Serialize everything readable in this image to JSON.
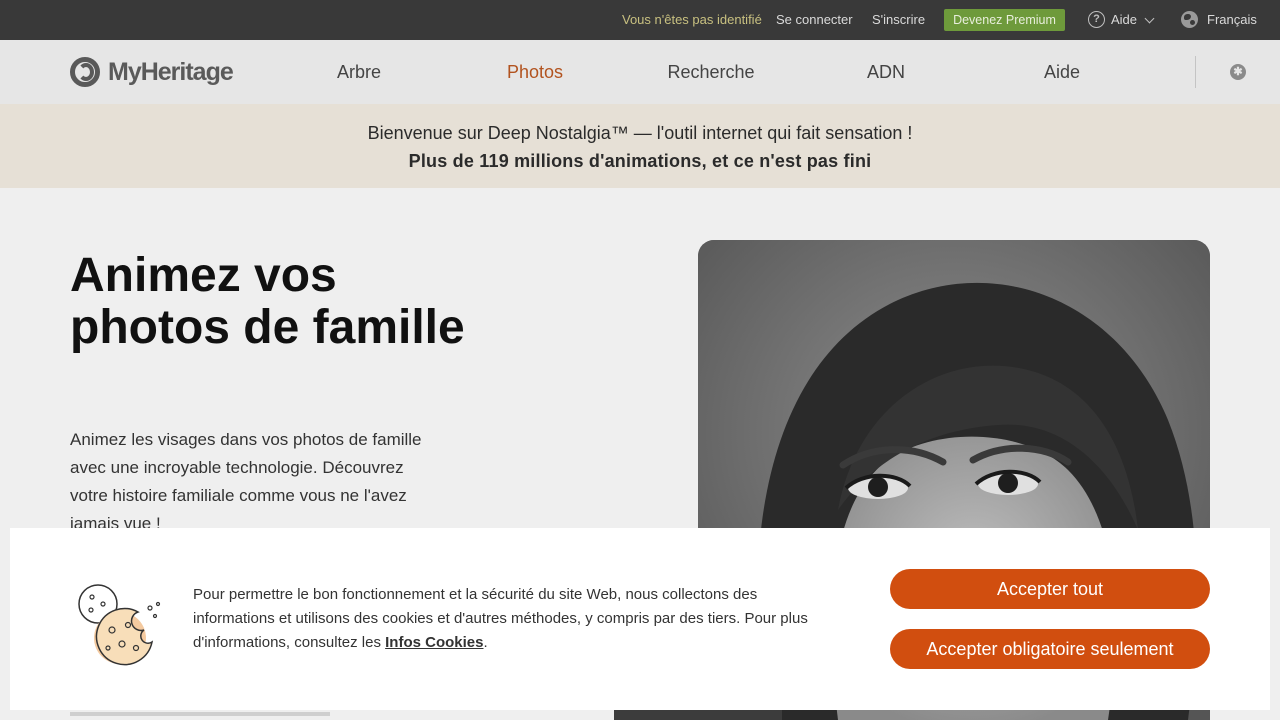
{
  "topbar": {
    "not_identified": "Vous n'êtes pas identifié",
    "login": "Se connecter",
    "signup": "S'inscrire",
    "premium": "Devenez Premium",
    "help_glyph": "?",
    "help": "Aide",
    "language": "Français"
  },
  "nav": {
    "logo": "MyHeritage",
    "items": [
      {
        "label": "Arbre"
      },
      {
        "label": "Photos",
        "active": true
      },
      {
        "label": "Recherche"
      },
      {
        "label": "ADN"
      },
      {
        "label": "Aide"
      }
    ],
    "accessibility_glyph": "✱"
  },
  "banner": {
    "line1": "Bienvenue sur Deep Nostalgia™ — l'outil internet qui fait sensation !",
    "line2": "Plus de 119 millions d'animations, et ce n'est pas fini"
  },
  "hero": {
    "title": "Animez vos photos de famille",
    "text": "Animez les visages dans vos photos de famille avec une incroyable technologie. Découvrez votre histoire familiale comme vous ne l'avez jamais vue !"
  },
  "cookie": {
    "text_before": "Pour permettre le bon fonctionnement et la sécurité du site Web, nous collectons des informations et utilisons des cookies et d'autres méthodes, y compris par des tiers. Pour plus d'informations, consultez les ",
    "link": "Infos Cookies",
    "text_after": ".",
    "accept_all": "Accepter tout",
    "accept_required": "Accepter obligatoire seulement"
  },
  "colors": {
    "accent": "#d14e0f",
    "premium_green": "#6e9a3b",
    "active_nav": "#b2531f"
  }
}
